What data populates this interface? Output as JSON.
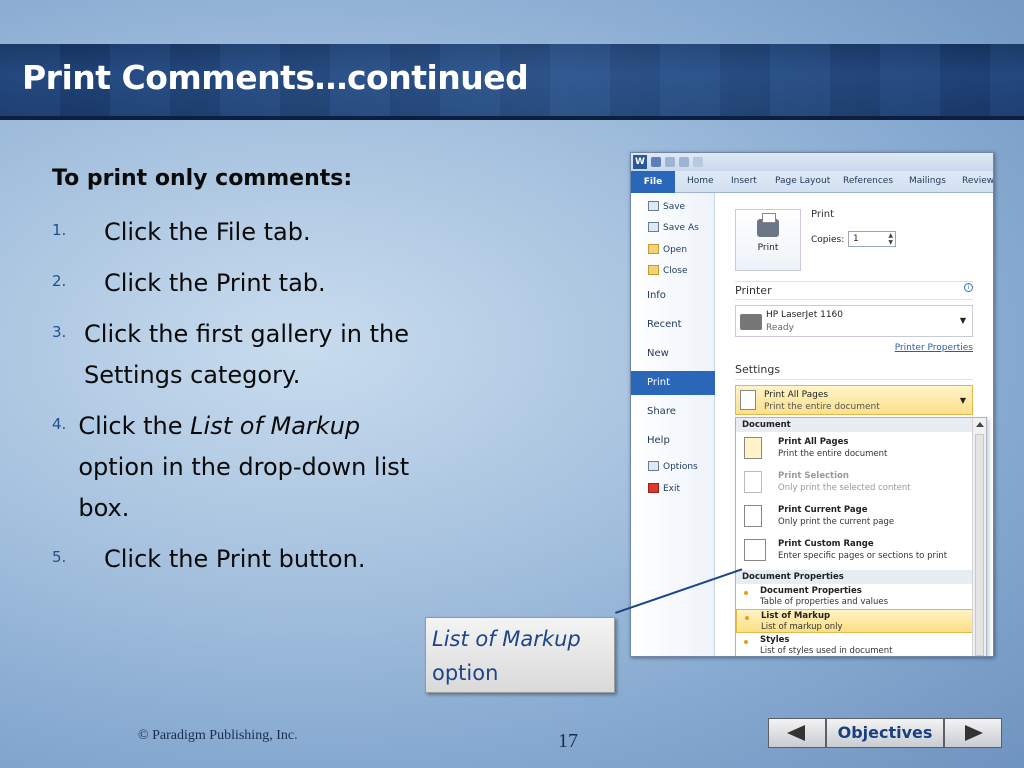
{
  "slide": {
    "title": "Print Comments…continued",
    "intro": "To print only comments:",
    "steps": [
      {
        "num": "1.",
        "text": "Click the File tab."
      },
      {
        "num": "2.",
        "text": "Click the Print tab."
      },
      {
        "num": "3.",
        "text": "Click the first gallery in the Settings category."
      },
      {
        "num": "4.",
        "pre": "Click the ",
        "em": "List of Markup",
        "post": " option in the drop-down list box."
      },
      {
        "num": "5.",
        "text": "Click the Print button."
      }
    ],
    "callout": {
      "em": "List of Markup",
      "text": "option"
    },
    "copyright": "© Paradigm Publishing, Inc.",
    "page_number": "17",
    "nav": {
      "objectives_label": "Objectives"
    }
  },
  "word": {
    "app_icon": "W",
    "tabs": [
      "File",
      "Home",
      "Insert",
      "Page Layout",
      "References",
      "Mailings",
      "Review"
    ],
    "side": {
      "save": "Save",
      "save_as": "Save As",
      "open": "Open",
      "close": "Close",
      "info": "Info",
      "recent": "Recent",
      "new": "New",
      "print": "Print",
      "share": "Share",
      "help": "Help",
      "options": "Options",
      "exit": "Exit"
    },
    "print": {
      "button_label": "Print",
      "heading": "Print",
      "copies_label": "Copies:",
      "copies_value": "1"
    },
    "printer": {
      "heading": "Printer",
      "name": "HP LaserJet 1160",
      "status": "Ready",
      "properties_link": "Printer Properties"
    },
    "settings": {
      "heading": "Settings",
      "selected_title": "Print All Pages",
      "selected_desc": "Print the entire document"
    },
    "dropdown": {
      "document_header": "Document",
      "items": [
        {
          "title": "Print All Pages",
          "desc": "Print the entire document"
        },
        {
          "title": "Print Selection",
          "desc": "Only print the selected content"
        },
        {
          "title": "Print Current Page",
          "desc": "Only print the current page"
        },
        {
          "title": "Print Custom Range",
          "desc": "Enter specific pages or sections to print"
        }
      ],
      "props_header": "Document Properties",
      "props": [
        {
          "title": "Document Properties",
          "desc": "Table of properties and values"
        },
        {
          "title": "List of Markup",
          "desc": "List of markup only"
        },
        {
          "title": "Styles",
          "desc": "List of styles used in document"
        }
      ]
    }
  },
  "colors": {
    "accent": "#2a67b8",
    "highlight": "#fcdf85",
    "title_band": "#1d3f74"
  }
}
